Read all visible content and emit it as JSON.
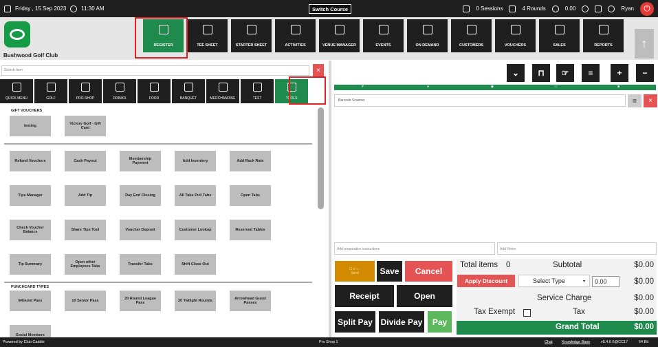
{
  "topbar": {
    "date": "Friday , 15 Sep 2023",
    "time": "11:30 AM",
    "switch_course": "Switch Course",
    "sessions": "0 Sessions",
    "rounds": "4 Rounds",
    "balance": "0.00",
    "user": "Ryan"
  },
  "header": {
    "club_name": "Bushwood Golf Club",
    "nav": [
      "REGISTER",
      "TEE SHEET",
      "STARTER SHEET",
      "ACTIVITIES",
      "VENUE MANAGER",
      "EVENTS",
      "ON DEMAND",
      "CUSTOMERS",
      "VOUCHERS",
      "SALES",
      "REPORTS"
    ]
  },
  "search": {
    "placeholder": "Search Item"
  },
  "categories": [
    "QUICK MENU",
    "GOLF",
    "PRO-SHOP",
    "DRINKS",
    "FOOD",
    "BANQUET",
    "MERCHANDISE",
    "TEST",
    "TOOLS"
  ],
  "sections": {
    "gift": "GIFT VOUCHERS",
    "punch": "PUNCHCARD TYPES"
  },
  "gift_items": [
    "testing",
    "Victory Golf - Gift Card"
  ],
  "tools": [
    "Refund Vouchers",
    "Cash Payout",
    "Membership Payment",
    "Add Inventory",
    "Add Rack Rate",
    "Tips Manager",
    "Add Tip",
    "Day End Closing",
    "All Tabs Pull Tabs",
    "Open Tabs",
    "Check Voucher Balance",
    "Share Tips Tool",
    "Voucher Deposit",
    "Customer Lookup",
    "Reserved Tables",
    "Tip Summary",
    "Open other Employees Tabs",
    "Transfer Tabs",
    "Shift Close Out"
  ],
  "punch_items": [
    "6Round Pass",
    "10 Senior Pass",
    "20 Round League Pass",
    "20 Twilight Rounds",
    "Arrowhead Guest Passes",
    "Social Members"
  ],
  "order": {
    "barcode_placeholder": "Barcode Scanner",
    "prep_placeholder": "Add preparation instructions",
    "notes_placeholder": "Add Notes"
  },
  "actions": {
    "send": "Send",
    "save": "Save",
    "cancel": "Cancel",
    "receipt": "Receipt",
    "open": "Open",
    "split": "Split Pay",
    "divide": "Divide Pay",
    "pay": "Pay"
  },
  "totals": {
    "items_label": "Total items",
    "items": "0",
    "subtotal_label": "Subtotal",
    "subtotal": "$0.00",
    "apply_discount": "Apply Discount",
    "select_type": "Select Type",
    "discount_value": "0.00",
    "discount": "$0.00",
    "service_label": "Service Charge",
    "service": "$0.00",
    "tax_exempt": "Tax Exempt",
    "tax_label": "Tax",
    "tax": "$0.00",
    "grand_label": "Grand Total",
    "grand": "$0.00"
  },
  "footer": {
    "powered": "Powered by Club Caddie",
    "station": "Pro Shop 1",
    "chat": "Chat",
    "kb": "Knowledge Base",
    "version": "v5.4.6.6@CC17",
    "bits": "64 Bit"
  },
  "colors": {
    "green": "#1e8a4c",
    "red": "#e55454",
    "dark": "#1f1f1f",
    "orange": "#d28a00"
  }
}
